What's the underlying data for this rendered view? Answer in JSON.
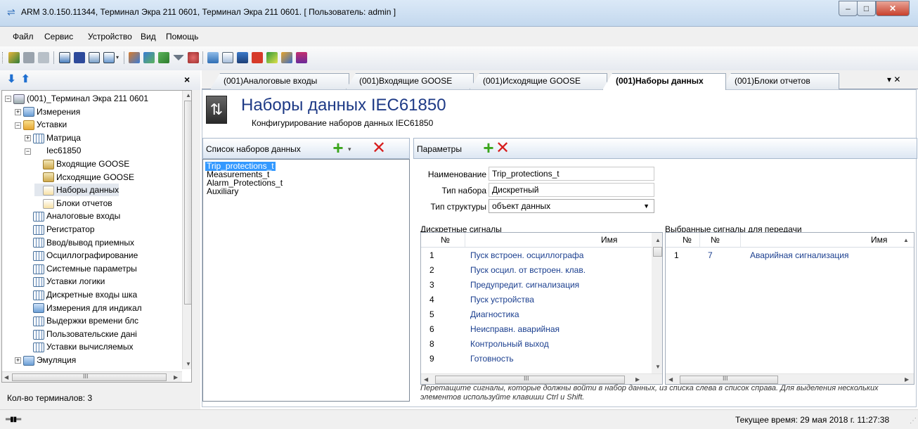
{
  "window": {
    "title": "ARM 3.0.150.11344, Терминал Экра 211 0601, Терминал Экра 211 0601. [ Пользователь: admin ]",
    "app_icon": "arm-app-icon",
    "controls": {
      "minimize": "–",
      "maximize": "□",
      "close": "✕"
    }
  },
  "menu": {
    "items": [
      "Файл",
      "Сервис",
      "Устройство",
      "Вид",
      "Помощь"
    ]
  },
  "left_panel": {
    "close": "×",
    "tree": [
      {
        "label": "(001)_Терминал Экра 211 0601",
        "level": 0,
        "expander": "−",
        "icon": "terminal-icon"
      },
      {
        "label": "Измерения",
        "level": 1,
        "expander": "+",
        "icon": "measurements-icon"
      },
      {
        "label": "Уставки",
        "level": 1,
        "expander": "−",
        "icon": "folder-icon"
      },
      {
        "label": "Матрица",
        "level": 2,
        "expander": "+",
        "icon": "matrix-icon"
      },
      {
        "label": "Iec61850",
        "level": 2,
        "expander": "−",
        "icon": "iec61850-icon"
      },
      {
        "label": "Входящие GOOSE",
        "level": 3,
        "expander": "",
        "icon": "goose-icon"
      },
      {
        "label": "Исходящие GOOSE",
        "level": 3,
        "expander": "",
        "icon": "goose-icon"
      },
      {
        "label": "Наборы данных",
        "level": 3,
        "expander": "",
        "icon": "datasets-icon",
        "selected": true
      },
      {
        "label": "Блоки отчетов",
        "level": 3,
        "expander": "",
        "icon": "reports-icon"
      },
      {
        "label": "Аналоговые входы",
        "level": 2,
        "expander": "",
        "icon": "table-icon"
      },
      {
        "label": "Регистратор",
        "level": 2,
        "expander": "",
        "icon": "table-icon"
      },
      {
        "label": "Ввод/вывод приемных",
        "level": 2,
        "expander": "",
        "icon": "table-icon"
      },
      {
        "label": "Осциллографирование",
        "level": 2,
        "expander": "",
        "icon": "table-icon"
      },
      {
        "label": "Системные параметры",
        "level": 2,
        "expander": "",
        "icon": "table-icon"
      },
      {
        "label": "Уставки логики",
        "level": 2,
        "expander": "",
        "icon": "table-icon"
      },
      {
        "label": "Дискретные входы шка",
        "level": 2,
        "expander": "",
        "icon": "table-icon"
      },
      {
        "label": "Измерения для индикал",
        "level": 2,
        "expander": "",
        "icon": "display-measurements-icon"
      },
      {
        "label": "Выдержки времени блс",
        "level": 2,
        "expander": "",
        "icon": "table-icon"
      },
      {
        "label": "Пользовательские дані",
        "level": 2,
        "expander": "",
        "icon": "table-icon"
      },
      {
        "label": "Уставки вычисляемых",
        "level": 2,
        "expander": "",
        "icon": "table-icon"
      },
      {
        "label": "Эмуляция",
        "level": 1,
        "expander": "+",
        "icon": "emulation-icon"
      }
    ],
    "hscroll_grip": "III",
    "terminals_count": "Кол-во терминалов: 3"
  },
  "tabs": [
    {
      "label": "(001)Аналоговые входы",
      "active": false
    },
    {
      "label": "(001)Входящие GOOSE",
      "active": false
    },
    {
      "label": "(001)Исходящие GOOSE",
      "active": false
    },
    {
      "label": "(001)Наборы данных",
      "active": true
    },
    {
      "label": "(001)Блоки отчетов",
      "active": false
    }
  ],
  "tab_menu": "▾ ✕",
  "header": {
    "title": "Наборы данных IEC61850",
    "subtitle": "Конфигурирование наборов данных IEC61850"
  },
  "datasets_panel": {
    "title": "Список наборов данных",
    "items": [
      "Trip_protections_t",
      "Measurements_t",
      "Alarm_Protections_t",
      "Auxiliary"
    ],
    "selected_index": 0
  },
  "params_panel": {
    "title": "Параметры",
    "name_label": "Наименование",
    "name_value": "Trip_protections_t",
    "type_label": "Тип набора",
    "type_value": "Дискретный",
    "structure_label": "Тип структуры",
    "structure_value": "объект данных"
  },
  "discrete_signals": {
    "label": "Дискретные сигналы",
    "columns": [
      "№",
      "Имя"
    ],
    "rows": [
      [
        "1",
        "Пуск встроен. осциллографа"
      ],
      [
        "2",
        "Пуск осцил. от встроен. клав."
      ],
      [
        "3",
        "Предупредит. сигнализация"
      ],
      [
        "4",
        "Пуск устройства"
      ],
      [
        "5",
        "Диагностика"
      ],
      [
        "6",
        "Неисправн. аварийная"
      ],
      [
        "8",
        "Контрольный выход"
      ],
      [
        "9",
        "Готовность"
      ]
    ],
    "hscroll_grip": "III"
  },
  "selected_signals": {
    "label": "Выбранные сигналы для передачи",
    "columns": [
      "№",
      "№",
      "Имя"
    ],
    "rows": [
      [
        "1",
        "7",
        "Аварийная сигнализация"
      ]
    ],
    "hscroll_grip": "III"
  },
  "hint": "Перетащите сигналы, которые должны войти в набор данных, из списка слева в список справа. Для выделения нескольких элементов используйте клавиши Ctrl и Shift.",
  "status": {
    "icon": "connection-icon",
    "time": "Текущее время: 29 мая 2018 г. 11:27:38"
  },
  "colors": {
    "header_title": "#1e3a86",
    "selection": "#3399ff",
    "add": "#3aa51c",
    "delete": "#d71e1e"
  }
}
